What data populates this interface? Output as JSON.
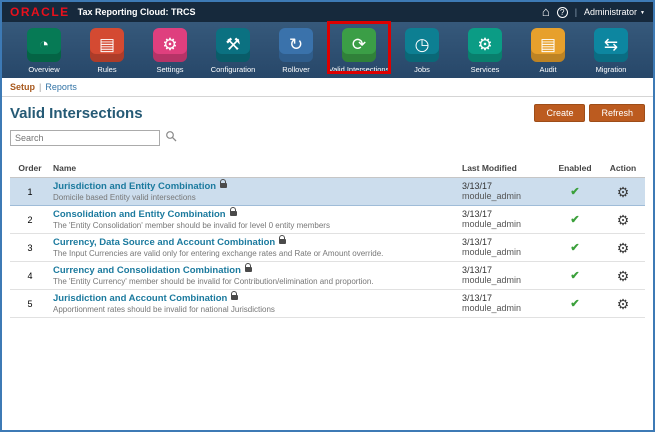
{
  "topbar": {
    "brand": "ORACLE",
    "title": "Tax Reporting Cloud: TRCS",
    "home_glyph": "⌂",
    "help_glyph": "?",
    "separator": "|",
    "user_label": "Administrator",
    "caret_glyph": "▼"
  },
  "nav": {
    "items": [
      {
        "id": "overview",
        "label": "Overview",
        "icon": "overview-gauge-icon",
        "glyph": "◔",
        "color": "#067a55"
      },
      {
        "id": "rules",
        "label": "Rules",
        "icon": "rules-icon",
        "glyph": "▤",
        "color": "#d44a32"
      },
      {
        "id": "settings",
        "label": "Settings",
        "icon": "settings-gear-icon",
        "glyph": "⚙",
        "color": "#df3f7e"
      },
      {
        "id": "configuration",
        "label": "Configuration",
        "icon": "configuration-wrench-icon",
        "glyph": "⚒",
        "color": "#0b7181"
      },
      {
        "id": "rollover",
        "label": "Rollover",
        "icon": "rollover-arrow-icon",
        "glyph": "↻",
        "color": "#3a72ab"
      },
      {
        "id": "valid-intersections",
        "label": "Valid Intersections",
        "icon": "valid-intersections-icon",
        "glyph": "⟳",
        "color": "#3b9e46",
        "highlighted": true
      },
      {
        "id": "jobs",
        "label": "Jobs",
        "icon": "jobs-clock-icon",
        "glyph": "◷",
        "color": "#0d7f92"
      },
      {
        "id": "services",
        "label": "Services",
        "icon": "services-gear-icon",
        "glyph": "⚙",
        "color": "#0b9c85"
      },
      {
        "id": "audit",
        "label": "Audit",
        "icon": "audit-list-icon",
        "glyph": "▤",
        "color": "#e7a02c"
      },
      {
        "id": "migration",
        "label": "Migration",
        "icon": "migration-arrows-icon",
        "glyph": "⇆",
        "color": "#0d86a0"
      }
    ]
  },
  "content": {
    "breadcrumb": {
      "setup": "Setup",
      "separator": "|",
      "reports": "Reports"
    },
    "title": "Valid Intersections",
    "create_label": "Create",
    "refresh_label": "Refresh",
    "search_placeholder": "Search"
  },
  "table": {
    "headers": [
      "Order",
      "Name",
      "Last Modified",
      "Enabled",
      "Action"
    ],
    "enabled_glyph": "✔",
    "action_glyph": "⚙",
    "rows": [
      {
        "order": "1",
        "name": "Jurisdiction and Entity Combination",
        "description": "Domicile based Entity valid intersections",
        "modified_date": "3/13/17",
        "modified_by": "module_admin",
        "enabled": true,
        "selected": true
      },
      {
        "order": "2",
        "name": "Consolidation and Entity Combination",
        "description": "The 'Entity Consolidation' member should be invalid for level 0 entity members",
        "modified_date": "3/13/17",
        "modified_by": "module_admin",
        "enabled": true,
        "selected": false
      },
      {
        "order": "3",
        "name": "Currency, Data Source and Account Combination",
        "description": "The Input Currencies are valid only for entering exchange rates and Rate or Amount override.",
        "modified_date": "3/13/17",
        "modified_by": "module_admin",
        "enabled": true,
        "selected": false
      },
      {
        "order": "4",
        "name": "Currency and Consolidation Combination",
        "description": "The 'Entity Currency' member should be invalid for Contribution/elimination and proportion.",
        "modified_date": "3/13/17",
        "modified_by": "module_admin",
        "enabled": true,
        "selected": false
      },
      {
        "order": "5",
        "name": "Jurisdiction and Account Combination",
        "description": "Apportionment rates should be invalid for national Jurisdictions",
        "modified_date": "3/13/17",
        "modified_by": "module_admin",
        "enabled": true,
        "selected": false
      }
    ]
  },
  "colors": {
    "window_border": "#3d7ab5",
    "topbar_bg": "#16293c",
    "navbar_bg": "#2d4f70",
    "accent_button": "#bc5b1f",
    "selected_row_bg": "#ccdded",
    "enabled_check": "#3ba03b",
    "annotation_red": "#dd0000"
  }
}
